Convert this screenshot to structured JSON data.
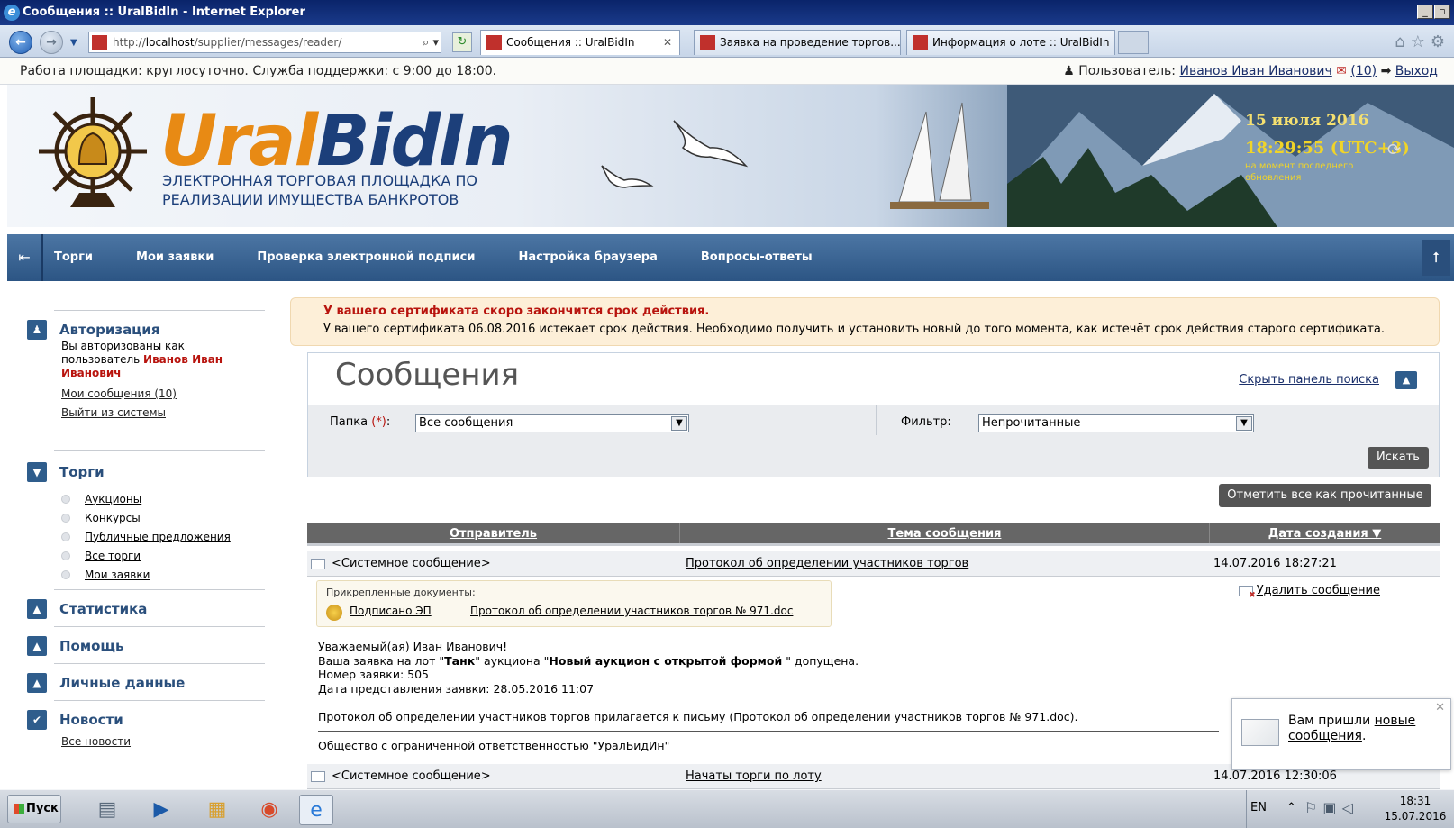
{
  "window": {
    "title": "Сообщения :: UralBidIn - Internet Explorer"
  },
  "browser": {
    "address_prefix": "http://",
    "address_host": "localhost",
    "address_path": "/supplier/messages/reader/",
    "tabs": [
      {
        "label": "Сообщения :: UralBidIn",
        "active": true
      },
      {
        "label": "Заявка на проведение торгов...",
        "active": false
      },
      {
        "label": "Информация о лоте :: UralBidIn",
        "active": false
      }
    ]
  },
  "infostrip": {
    "left": "Работа площадки: круглосуточно. Служба поддержки: с 9:00 до 18:00.",
    "user_label": "Пользователь:",
    "user_name": "Иванов Иван Иванович",
    "messages_count": "(10)",
    "logout": "Выход"
  },
  "banner": {
    "logo_ural": "Ural",
    "logo_bidin": "BidIn",
    "tagline_1": "ЭЛЕКТРОННАЯ ТОРГОВАЯ ПЛОЩАДКА ПО",
    "tagline_2": "РЕАЛИЗАЦИИ ИМУЩЕСТВА БАНКРОТОВ",
    "date": "15 июля 2016",
    "time": "18:29:55 (UTC+3)",
    "time_note": "на момент последнего обновления"
  },
  "nav": {
    "items": [
      "Торги",
      "Мои заявки",
      "Проверка электронной подписи",
      "Настройка браузера",
      "Вопросы-ответы"
    ]
  },
  "sidebar": {
    "auth": {
      "title": "Авторизация",
      "text": "Вы авторизованы как пользователь",
      "user": "Иванов Иван Иванович",
      "my_messages": "Мои сообщения (10)",
      "logout": "Выйти из системы"
    },
    "trades": {
      "title": "Торги",
      "items": [
        "Аукционы",
        "Конкурсы",
        "Публичные предложения",
        "Все торги",
        "Мои заявки"
      ]
    },
    "stats": {
      "title": "Статистика"
    },
    "help": {
      "title": "Помощь"
    },
    "personal": {
      "title": "Личные данные"
    },
    "news": {
      "title": "Новости",
      "all": "Все новости"
    }
  },
  "warning": {
    "title": "У вашего сертификата скоро закончится срок действия.",
    "text": "У вашего сертификата 06.08.2016 истекает срок действия. Необходимо получить и установить новый до того момента, как истечёт срок действия старого сертификата."
  },
  "search": {
    "page_title": "Сообщения",
    "hide_panel": "Скрыть панель поиска",
    "folder_label": "Папка",
    "folder_required": "(*)",
    "folder_colon": ":",
    "folder_value": "Все сообщения",
    "filter_label": "Фильтр:",
    "filter_value": "Непрочитанные",
    "search_button": "Искать",
    "mark_all_button": "Отметить все как прочитанные"
  },
  "table": {
    "headers": {
      "sender": "Отправитель",
      "subject": "Тема сообщения",
      "date": "Дата создания ▼"
    },
    "rows": [
      {
        "sender": "<Системное сообщение>",
        "subject": "Протокол об определении участников торгов",
        "date": "14.07.2016 18:27:21"
      },
      {
        "sender": "<Системное сообщение>",
        "subject": "Начаты торги по лоту",
        "date": "14.07.2016 12:30:06"
      }
    ]
  },
  "message": {
    "attached_label": "Прикрепленные документы:",
    "signed": "Подписано ЭП",
    "file": "Протокол об определении участников торгов № 971.doc",
    "delete": "Удалить сообщение",
    "greeting": "Уважаемый(ая) Иван Иванович!",
    "line1_a": "Ваша заявка на лот \"",
    "line1_lot": "Танк",
    "line1_b": "\" аукциона \"",
    "line1_auction": "Новый аукцион с открытой формой",
    "line1_c": " \" допущена.",
    "line2": "Номер заявки: 505",
    "line3": "Дата представления заявки: 28.05.2016 11:07",
    "protocol_line": "Протокол об определении участников торгов прилагается к письму (Протокол об определении участников торгов № 971.doc).",
    "signature": "Общество с ограниченной ответственностью \"УралБидИн\""
  },
  "toast": {
    "text_a": "Вам пришли ",
    "link": "новые сообщения",
    "text_b": "."
  },
  "taskbar": {
    "start": "Пуск",
    "lang": "EN",
    "time": "18:31",
    "date": "15.07.2016"
  }
}
